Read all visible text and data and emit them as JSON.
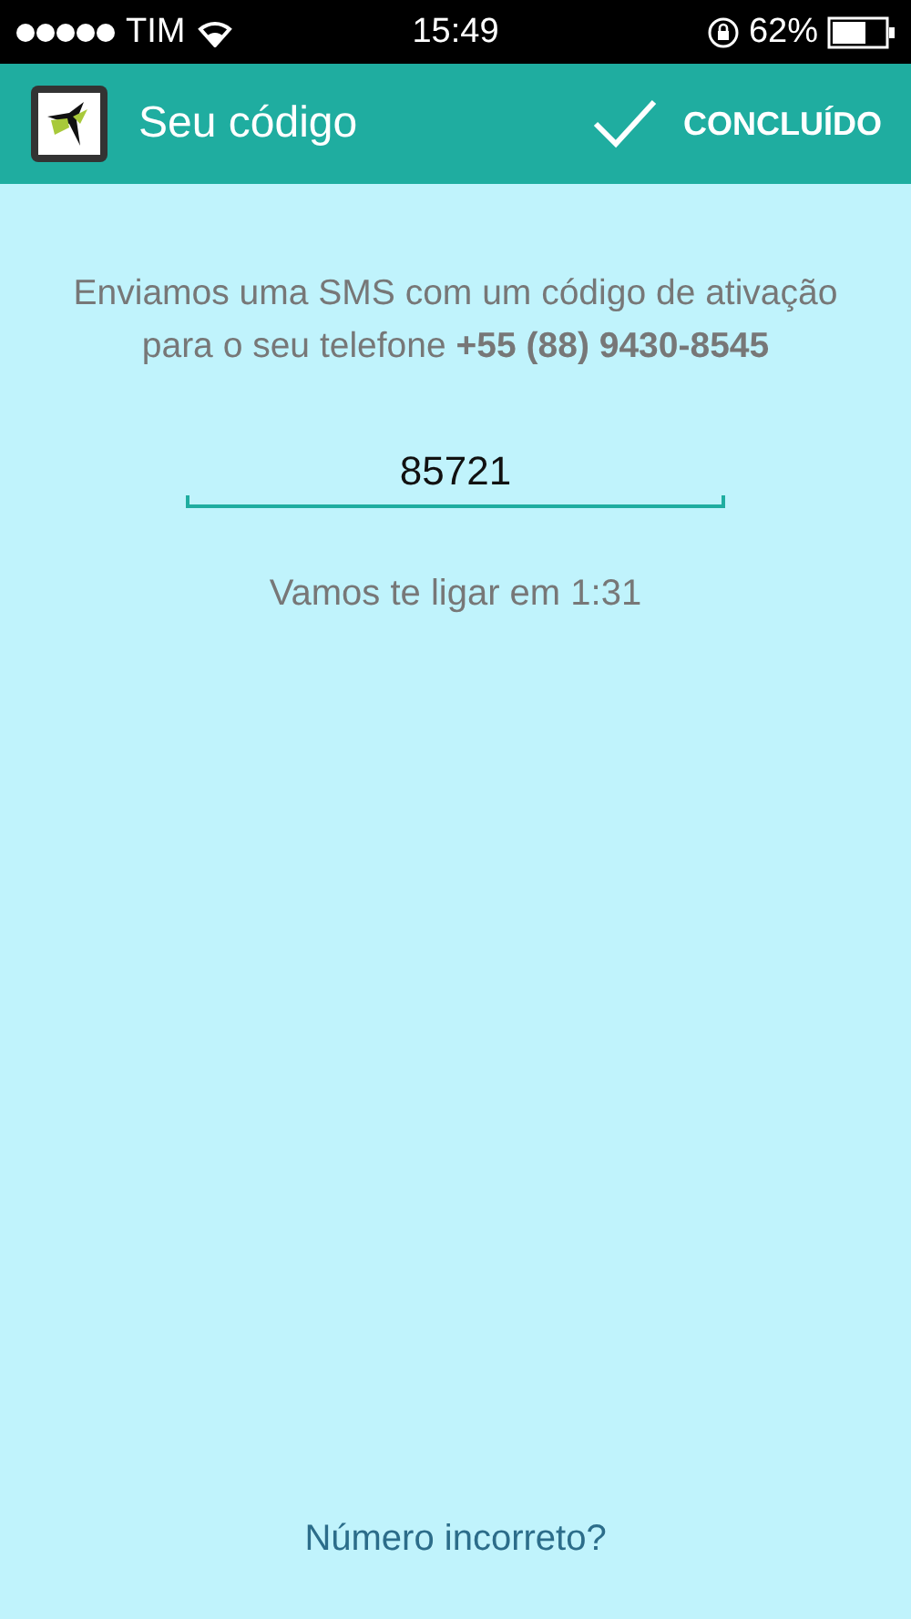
{
  "status_bar": {
    "carrier": "TIM",
    "time": "15:49",
    "battery": "62%"
  },
  "toolbar": {
    "title": "Seu código",
    "action": "CONCLUÍDO"
  },
  "message": "Enviamos uma SMS com um código de ativação para o seu telefone **+55 (88) 9430-8545**",
  "code_field": {
    "value": "85721"
  },
  "countdown": "Vamos te ligar em 1:31",
  "link": "Número incorreto?"
}
